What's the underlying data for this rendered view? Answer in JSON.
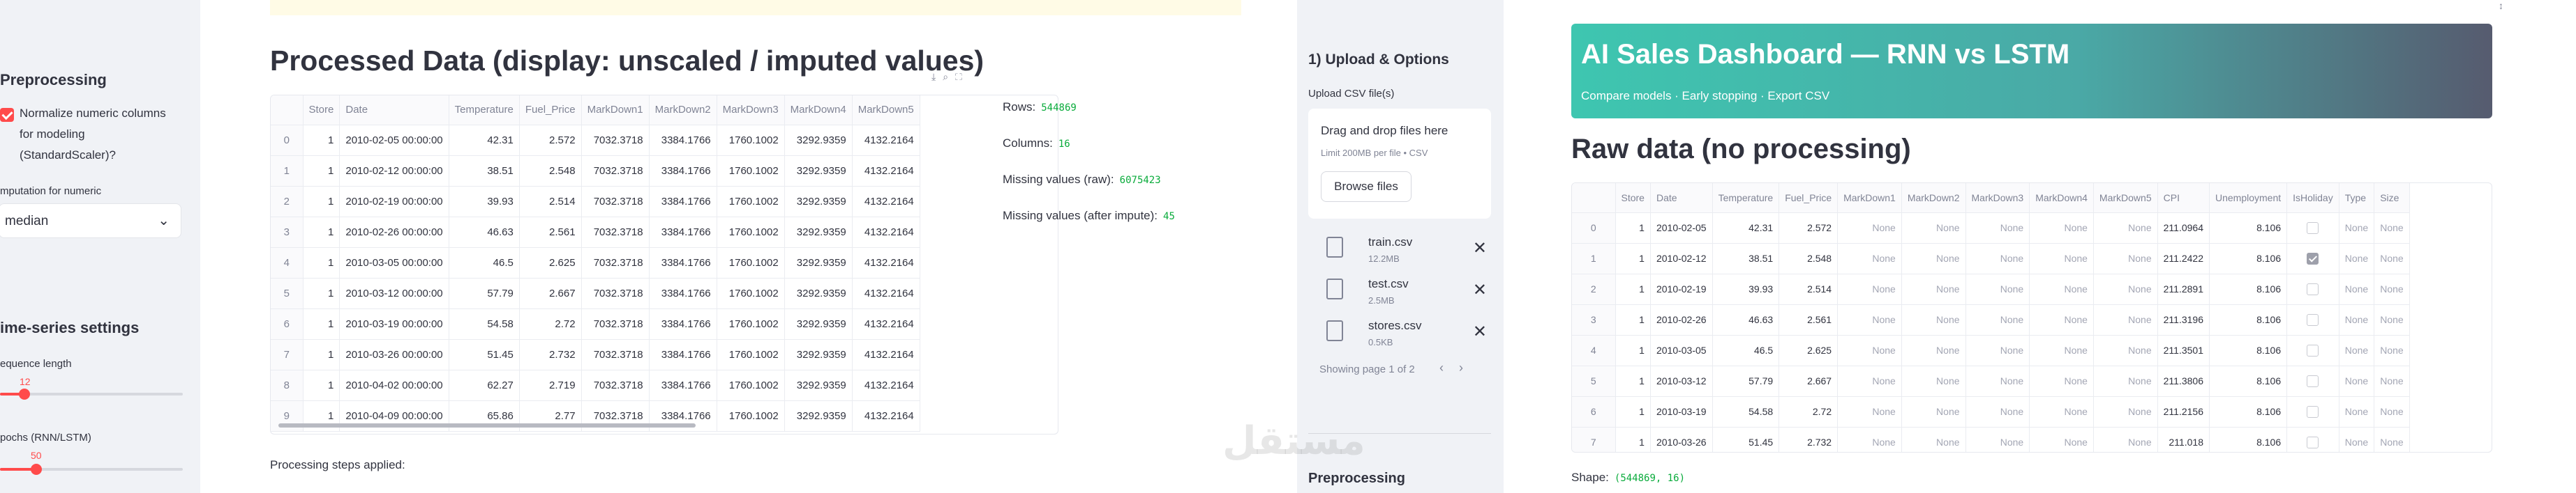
{
  "p1_sidebar": {
    "preprocessing_heading": "Preprocessing",
    "normalize_label_l1": "Normalize numeric columns",
    "normalize_label_l2": "for modeling",
    "normalize_label_l3": "(StandardScaler)?",
    "imputation_label": "mputation for numeric",
    "imputation_value": "median",
    "timeseries_heading": "ime-series settings",
    "seq_label": "equence length",
    "seq_value": "12",
    "epochs_label": "pochs (RNN/LSTM)",
    "epochs_value": "50"
  },
  "p1_main": {
    "title": "Processed Data (display: unscaled / imputed values)",
    "columns": [
      "",
      "Store",
      "Date",
      "Temperature",
      "Fuel_Price",
      "MarkDown1",
      "MarkDown2",
      "MarkDown3",
      "MarkDown4",
      "MarkDown5"
    ],
    "rows": [
      [
        "0",
        "1",
        "2010-02-05 00:00:00",
        "42.31",
        "2.572",
        "7032.3718",
        "3384.1766",
        "1760.1002",
        "3292.9359",
        "4132.2164"
      ],
      [
        "1",
        "1",
        "2010-02-12 00:00:00",
        "38.51",
        "2.548",
        "7032.3718",
        "3384.1766",
        "1760.1002",
        "3292.9359",
        "4132.2164"
      ],
      [
        "2",
        "1",
        "2010-02-19 00:00:00",
        "39.93",
        "2.514",
        "7032.3718",
        "3384.1766",
        "1760.1002",
        "3292.9359",
        "4132.2164"
      ],
      [
        "3",
        "1",
        "2010-02-26 00:00:00",
        "46.63",
        "2.561",
        "7032.3718",
        "3384.1766",
        "1760.1002",
        "3292.9359",
        "4132.2164"
      ],
      [
        "4",
        "1",
        "2010-03-05 00:00:00",
        "46.5",
        "2.625",
        "7032.3718",
        "3384.1766",
        "1760.1002",
        "3292.9359",
        "4132.2164"
      ],
      [
        "5",
        "1",
        "2010-03-12 00:00:00",
        "57.79",
        "2.667",
        "7032.3718",
        "3384.1766",
        "1760.1002",
        "3292.9359",
        "4132.2164"
      ],
      [
        "6",
        "1",
        "2010-03-19 00:00:00",
        "54.58",
        "2.72",
        "7032.3718",
        "3384.1766",
        "1760.1002",
        "3292.9359",
        "4132.2164"
      ],
      [
        "7",
        "1",
        "2010-03-26 00:00:00",
        "51.45",
        "2.732",
        "7032.3718",
        "3384.1766",
        "1760.1002",
        "3292.9359",
        "4132.2164"
      ],
      [
        "8",
        "1",
        "2010-04-02 00:00:00",
        "62.27",
        "2.719",
        "7032.3718",
        "3384.1766",
        "1760.1002",
        "3292.9359",
        "4132.2164"
      ],
      [
        "9",
        "1",
        "2010-04-09 00:00:00",
        "65.86",
        "2.77",
        "7032.3718",
        "3384.1766",
        "1760.1002",
        "3292.9359",
        "4132.2164"
      ]
    ],
    "rows_label": "Rows:",
    "rows_value": "544869",
    "columns_label": "Columns:",
    "columns_value": "16",
    "missing_raw_label": "Missing values (raw):",
    "missing_raw_value": "6075423",
    "missing_after_label": "Missing values (after impute):",
    "missing_after_value": "45",
    "steps_label": "Processing steps applied:"
  },
  "p2_sidebar": {
    "section_title": "1) Upload & Options",
    "upload_label": "Upload CSV file(s)",
    "drop_text": "Drag and drop files here",
    "limit_text": "Limit 200MB per file • CSV",
    "browse_label": "Browse files",
    "files": [
      {
        "name": "train.csv",
        "size": "12.2MB"
      },
      {
        "name": "test.csv",
        "size": "2.5MB"
      },
      {
        "name": "stores.csv",
        "size": "0.5KB"
      }
    ],
    "pagination_text": "Showing page 1 of 2",
    "preprocessing_heading": "Preprocessing"
  },
  "p3": {
    "banner_title": "AI Sales Dashboard — RNN vs LSTM",
    "banner_subtitle": "Compare models · Early stopping · Export CSV",
    "title": "Raw data (no processing)",
    "columns": [
      "",
      "Store",
      "Date",
      "Temperature",
      "Fuel_Price",
      "MarkDown1",
      "MarkDown2",
      "MarkDown3",
      "MarkDown4",
      "MarkDown5",
      "CPI",
      "Unemployment",
      "IsHoliday",
      "Type",
      "Size"
    ],
    "rows": [
      [
        "0",
        "1",
        "2010-02-05",
        "42.31",
        "2.572",
        "None",
        "None",
        "None",
        "None",
        "None",
        "211.0964",
        "8.106",
        "false",
        "None",
        "None"
      ],
      [
        "1",
        "1",
        "2010-02-12",
        "38.51",
        "2.548",
        "None",
        "None",
        "None",
        "None",
        "None",
        "211.2422",
        "8.106",
        "true",
        "None",
        "None"
      ],
      [
        "2",
        "1",
        "2010-02-19",
        "39.93",
        "2.514",
        "None",
        "None",
        "None",
        "None",
        "None",
        "211.2891",
        "8.106",
        "false",
        "None",
        "None"
      ],
      [
        "3",
        "1",
        "2010-02-26",
        "46.63",
        "2.561",
        "None",
        "None",
        "None",
        "None",
        "None",
        "211.3196",
        "8.106",
        "false",
        "None",
        "None"
      ],
      [
        "4",
        "1",
        "2010-03-05",
        "46.5",
        "2.625",
        "None",
        "None",
        "None",
        "None",
        "None",
        "211.3501",
        "8.106",
        "false",
        "None",
        "None"
      ],
      [
        "5",
        "1",
        "2010-03-12",
        "57.79",
        "2.667",
        "None",
        "None",
        "None",
        "None",
        "None",
        "211.3806",
        "8.106",
        "false",
        "None",
        "None"
      ],
      [
        "6",
        "1",
        "2010-03-19",
        "54.58",
        "2.72",
        "None",
        "None",
        "None",
        "None",
        "None",
        "211.2156",
        "8.106",
        "false",
        "None",
        "None"
      ],
      [
        "7",
        "1",
        "2010-03-26",
        "51.45",
        "2.732",
        "None",
        "None",
        "None",
        "None",
        "None",
        "211.018",
        "8.106",
        "false",
        "None",
        "None"
      ]
    ],
    "shape_label": "Shape:",
    "shape_value": "(544869, 16)"
  },
  "watermark": "مستقل"
}
